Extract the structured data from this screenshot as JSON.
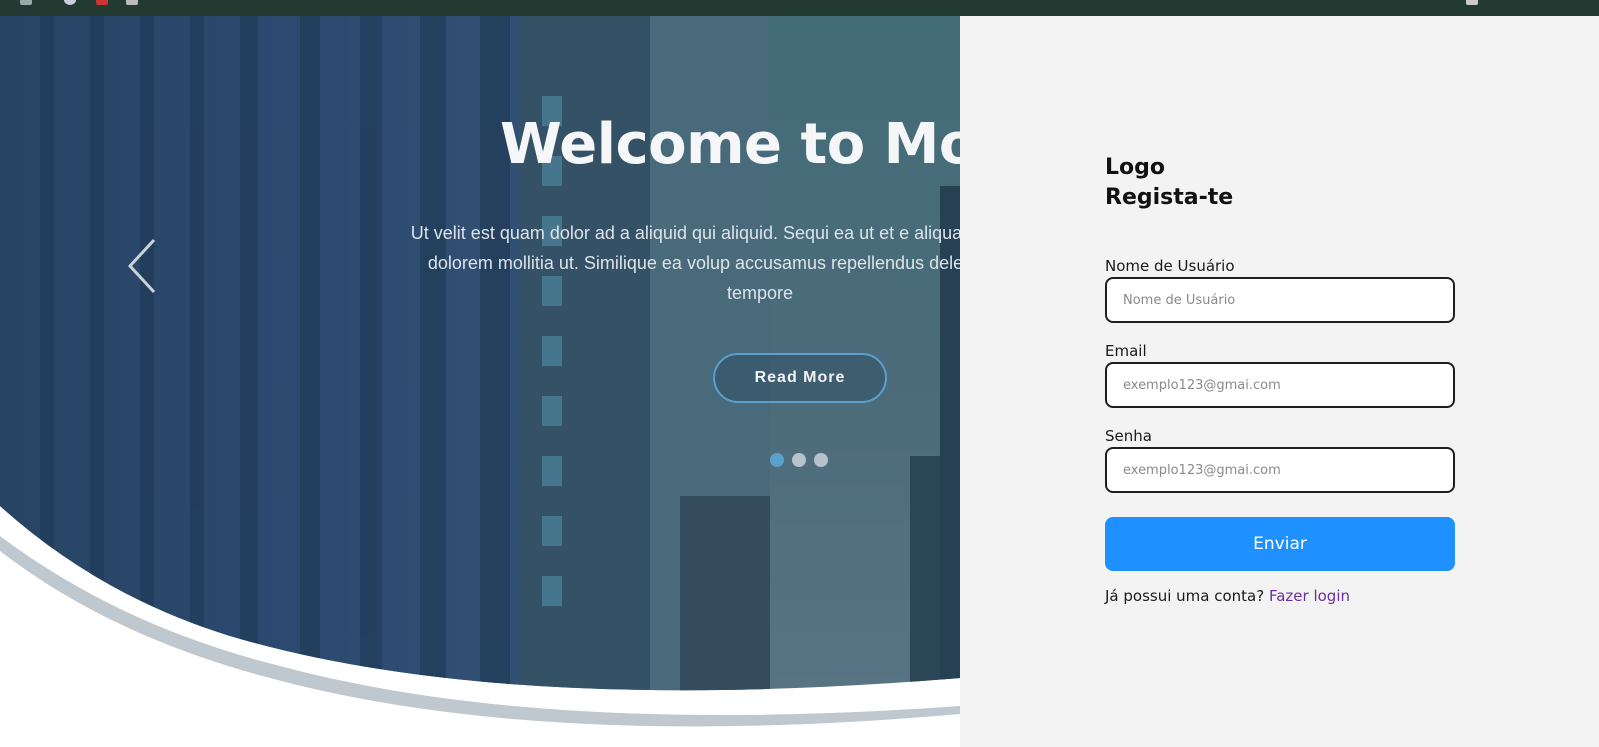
{
  "hero": {
    "title": "Welcome to Moo",
    "text": "Ut velit est quam dolor ad a aliquid qui aliquid. Sequi ea ut et e aliquam. Occaecati alias dolorem mollitia ut. Similique ea volup accusamus repellendus deleniti vel. Minus et tempore",
    "read_more_label": "Read More",
    "slides_total": 3,
    "slide_active": 1,
    "prev_icon": "chevron-left-icon"
  },
  "form": {
    "logo": "Logo",
    "heading": "Regista-te",
    "fields": [
      {
        "label": "Nome de Usuário",
        "placeholder": "Nome de Usuário",
        "value": ""
      },
      {
        "label": "Email",
        "placeholder": "exemplo123@gmai.com",
        "value": ""
      },
      {
        "label": "Senha",
        "placeholder": "exemplo123@gmai.com",
        "value": ""
      }
    ],
    "submit_label": "Enviar",
    "login_prompt": "Já possui uma conta?",
    "login_link": "Fazer login"
  },
  "colors": {
    "topbar": "#233a33",
    "panel_bg": "#f3f3f3",
    "submit_bg": "#1e90ff",
    "link": "#6b2f9e",
    "hero_overlay": "#2c4a66"
  }
}
